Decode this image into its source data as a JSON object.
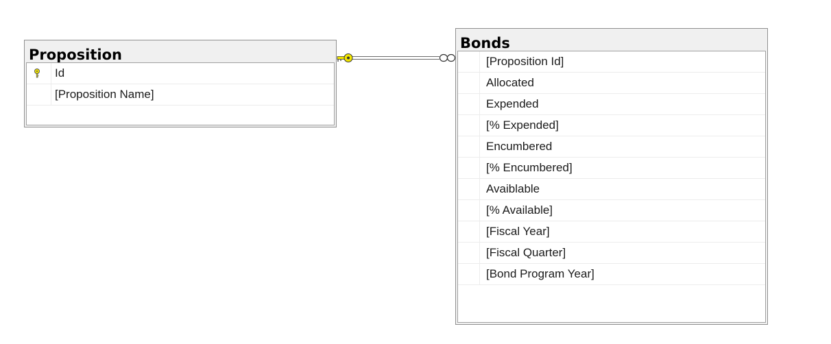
{
  "tables": {
    "proposition": {
      "name": "Proposition",
      "columns": [
        {
          "name": "Id",
          "primary_key": true
        },
        {
          "name": "[Proposition Name]",
          "primary_key": false
        }
      ]
    },
    "bonds": {
      "name": "Bonds",
      "columns": [
        {
          "name": "[Proposition Id]"
        },
        {
          "name": "Allocated"
        },
        {
          "name": "Expended"
        },
        {
          "name": "[% Expended]"
        },
        {
          "name": "Encumbered"
        },
        {
          "name": "[% Encumbered]"
        },
        {
          "name": "Avaiblable"
        },
        {
          "name": "[% Available]"
        },
        {
          "name": "[Fiscal Year]"
        },
        {
          "name": "[Fiscal Quarter]"
        },
        {
          "name": "[Bond Program Year]"
        }
      ]
    }
  },
  "relationship": {
    "from": "Proposition",
    "to": "Bonds",
    "from_end": "key-icon",
    "to_end": "infinity-icon",
    "line_color": "#555555",
    "key_color": "#f2e600"
  },
  "colors": {
    "title_bar": "#f0f0f0",
    "border": "#8f8f8f",
    "grid_line": "#ececec"
  }
}
